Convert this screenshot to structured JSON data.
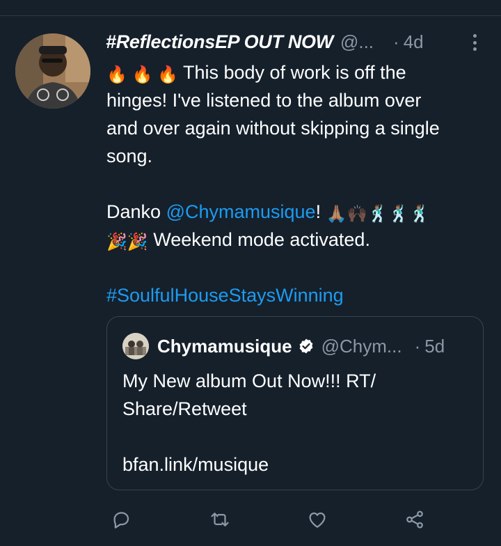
{
  "tweet": {
    "display_name": "#ReflectionsEP OUT NOW",
    "handle": "@...",
    "separator": "·",
    "time": "4d",
    "lines": [
      {
        "emoji": "🔥 🔥 🔥",
        "text": " This body of work is off the"
      },
      {
        "text": "hinges! I've listened to the album over"
      },
      {
        "text": "and over again without skipping a single"
      },
      {
        "text": "song."
      }
    ],
    "danko_prefix": "Danko ",
    "mention": "@Chymamusique",
    "mention_suffix": "!",
    "danko_emojis": "🙏🏽🙌🏿🕺🏽🕺🏽🕺🏽",
    "weekend_emojis": "🎉🎉",
    "weekend_text": " Weekend mode activated.",
    "hashtag": "#SoulfulHouseStaysWinning"
  },
  "quote": {
    "name": "Chymamusique",
    "handle": "@Chym...",
    "separator": "·",
    "time": "5d",
    "line1": "My New album Out Now!!! RT/",
    "line2": "Share/Retweet",
    "link": "bfan.link/musique"
  },
  "icons": {
    "reply": "reply-icon",
    "retweet": "retweet-icon",
    "like": "heart-icon",
    "share": "share-icon",
    "more": "more-icon",
    "verified": "verified-badge-icon"
  },
  "colors": {
    "background": "#15202b",
    "text": "#ffffff",
    "secondary": "#8b98a5",
    "link": "#1d9bf0",
    "border": "#38444d"
  }
}
